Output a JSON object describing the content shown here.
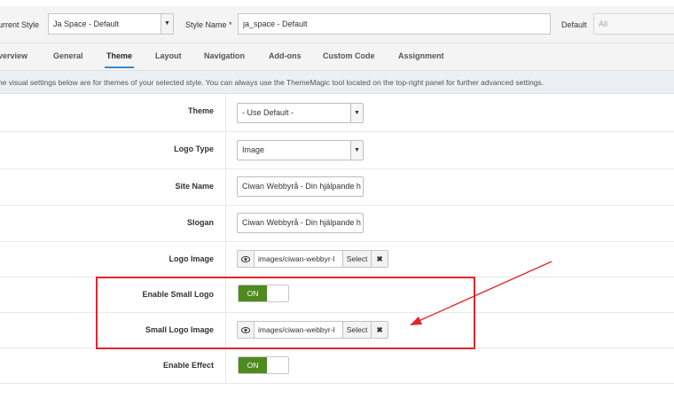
{
  "style_bar": {
    "current_style_label": "urrent Style",
    "current_style_value": "Ja Space - Default",
    "style_name_label": "Style Name *",
    "style_name_value": "ja_space - Default",
    "default_label": "Default",
    "default_value": "All"
  },
  "tabs": [
    {
      "label": "verview"
    },
    {
      "label": "General"
    },
    {
      "label": "Theme",
      "active": true
    },
    {
      "label": "Layout"
    },
    {
      "label": "Navigation"
    },
    {
      "label": "Add-ons"
    },
    {
      "label": "Custom Code"
    },
    {
      "label": "Assignment"
    }
  ],
  "info_text": "he visual settings below are for themes of your selected style. You can always use the ThemeMagic tool located on the top-right panel for further advanced settings.",
  "settings": {
    "theme": {
      "label": "Theme",
      "value": "- Use Default -"
    },
    "logo_type": {
      "label": "Logo Type",
      "value": "Image"
    },
    "site_name": {
      "label": "Site Name",
      "value": "Ciwan Webbyrå - Din hjälpande h"
    },
    "slogan": {
      "label": "Slogan",
      "value": "Ciwan Webbyrå - Din hjälpande h"
    },
    "logo_image": {
      "label": "Logo Image",
      "path": "images/ciwan-webbyr-l",
      "select_label": "Select",
      "clear_symbol": "✖"
    },
    "enable_small_logo": {
      "label": "Enable Small Logo",
      "on_label": "ON"
    },
    "small_logo_image": {
      "label": "Small Logo Image",
      "path": "images/ciwan-webbyr-l",
      "select_label": "Select",
      "clear_symbol": "✖"
    },
    "enable_effect": {
      "label": "Enable Effect",
      "on_label": "ON"
    }
  },
  "colors": {
    "accent": "#3b89c9",
    "toggle_on": "#4e8a1e",
    "annotation": "#e0262b"
  },
  "icons": {
    "dropdown": "chevron-down-icon",
    "preview": "eye-icon",
    "clear": "close-icon"
  }
}
